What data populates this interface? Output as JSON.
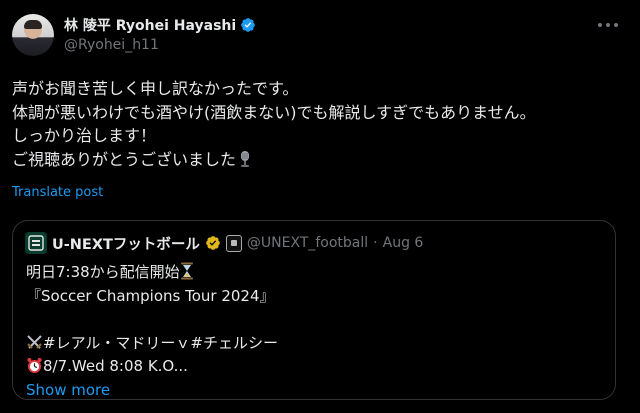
{
  "author": {
    "display_name": "林 陵平 Ryohei Hayashi",
    "handle": "@Ryohei_h11",
    "verified_color": "#1d9bf0"
  },
  "post": {
    "lines": [
      "声がお聞き苦しく申し訳なかったです。",
      "体調が悪いわけでも酒やけ(酒飲まない)でも解説しすぎでもありません。",
      "しっかり治します！",
      "ご視聴ありがとうございました"
    ],
    "trailing_emoji": "studio-microphone-icon",
    "translate_label": "Translate post"
  },
  "quoted_post": {
    "avatar_icon": "unext-logo-icon",
    "display_name": "U-NEXTフットボール",
    "verified_color": "#e2b719",
    "affiliate_badge": "affiliate-badge-icon",
    "handle": "@UNEXT_football",
    "separator": "·",
    "date": "Aug 6",
    "lines": [
      "明日7:38から配信開始",
      "『Soccer Champions Tour 2024』",
      "",
      "#レアル・マドリーｖ#チェルシー",
      "8/7.Wed 8:08 K.O..."
    ],
    "line_icons": [
      "hourglass-icon",
      "",
      "",
      "crossed-swords-icon",
      "alarm-clock-icon"
    ],
    "show_more_label": "Show more"
  },
  "colors": {
    "background": "#000000",
    "text": "#e7e9ea",
    "secondary": "#71767b",
    "link": "#1d9bf0",
    "border": "#2f3336"
  }
}
